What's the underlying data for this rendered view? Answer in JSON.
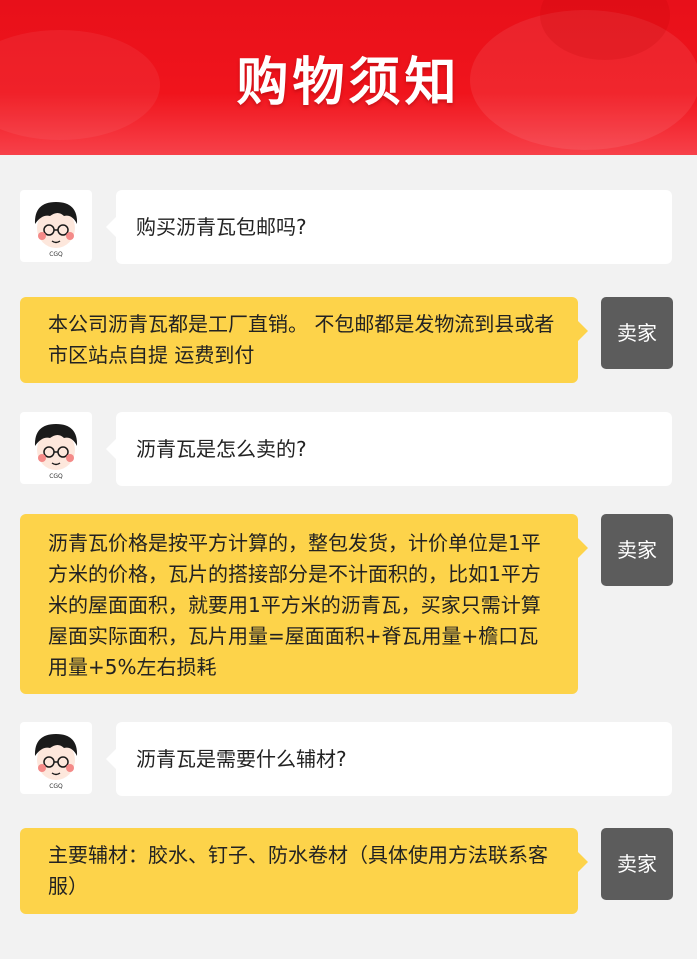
{
  "banner": {
    "title": "购物须知"
  },
  "avatar": {
    "caption": "CGQ"
  },
  "seller_label": "卖家",
  "faq": [
    {
      "question": "购买沥青瓦包邮吗?",
      "answer": "本公司沥青瓦都是工厂直销。 不包邮都是发物流到县或者市区站点自提 运费到付"
    },
    {
      "question": "沥青瓦是怎么卖的?",
      "answer": "沥青瓦价格是按平方计算的，整包发货，计价单位是1平方米的价格，瓦片的搭接部分是不计面积的，比如1平方米的屋面面积，就要用1平方米的沥青瓦，买家只需计算屋面实际面积，瓦片用量=屋面面积+脊瓦用量+檐口瓦用量+5%左右损耗"
    },
    {
      "question": "沥青瓦是需要什么辅材?",
      "answer": "主要辅材：胶水、钉子、防水卷材（具体使用方法联系客服）"
    }
  ]
}
